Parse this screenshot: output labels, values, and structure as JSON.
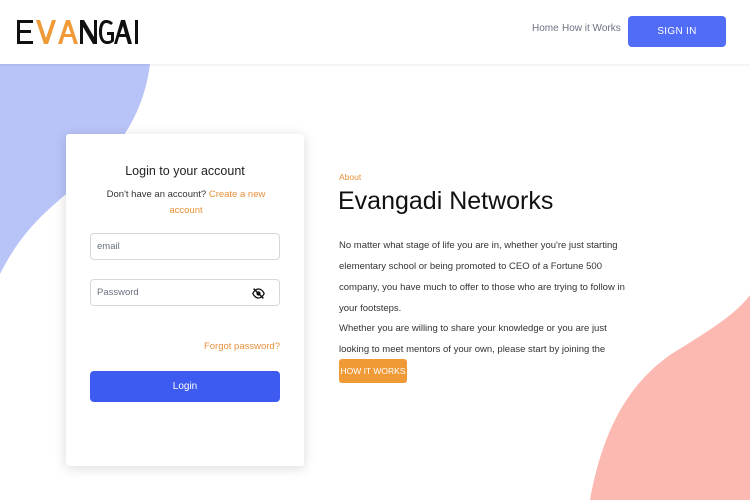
{
  "header": {
    "logo_text": "EVANGADI",
    "nav": {
      "home": "Home",
      "how_it_works": "How it Works"
    },
    "signin_label": "SIGN IN"
  },
  "login": {
    "title": "Login to your account",
    "no_account_text": "Don't have an account?",
    "create_link": "Create a new account",
    "email_placeholder": "email",
    "password_placeholder": "Password",
    "forgot_label": "Forgot password?",
    "login_label": "Login"
  },
  "about": {
    "label": "About",
    "title": "Evangadi Networks",
    "paragraph1": "No matter what stage of life you are in, whether you're just starting elementary school or being promoted to CEO of a Fortune 500 company, you have much to offer to those who are trying to follow in your footsteps.",
    "paragraph2": "Whether you are willing to share your knowledge or you are just looking to meet mentors of your own, please start by joining the network here.",
    "button_label": "HOW IT WORKS"
  },
  "colors": {
    "accent_orange": "#ef9a37",
    "primary_blue": "#3d5af1",
    "blob_blue": "#b8c4f8",
    "blob_pink": "#fbb9b2"
  }
}
